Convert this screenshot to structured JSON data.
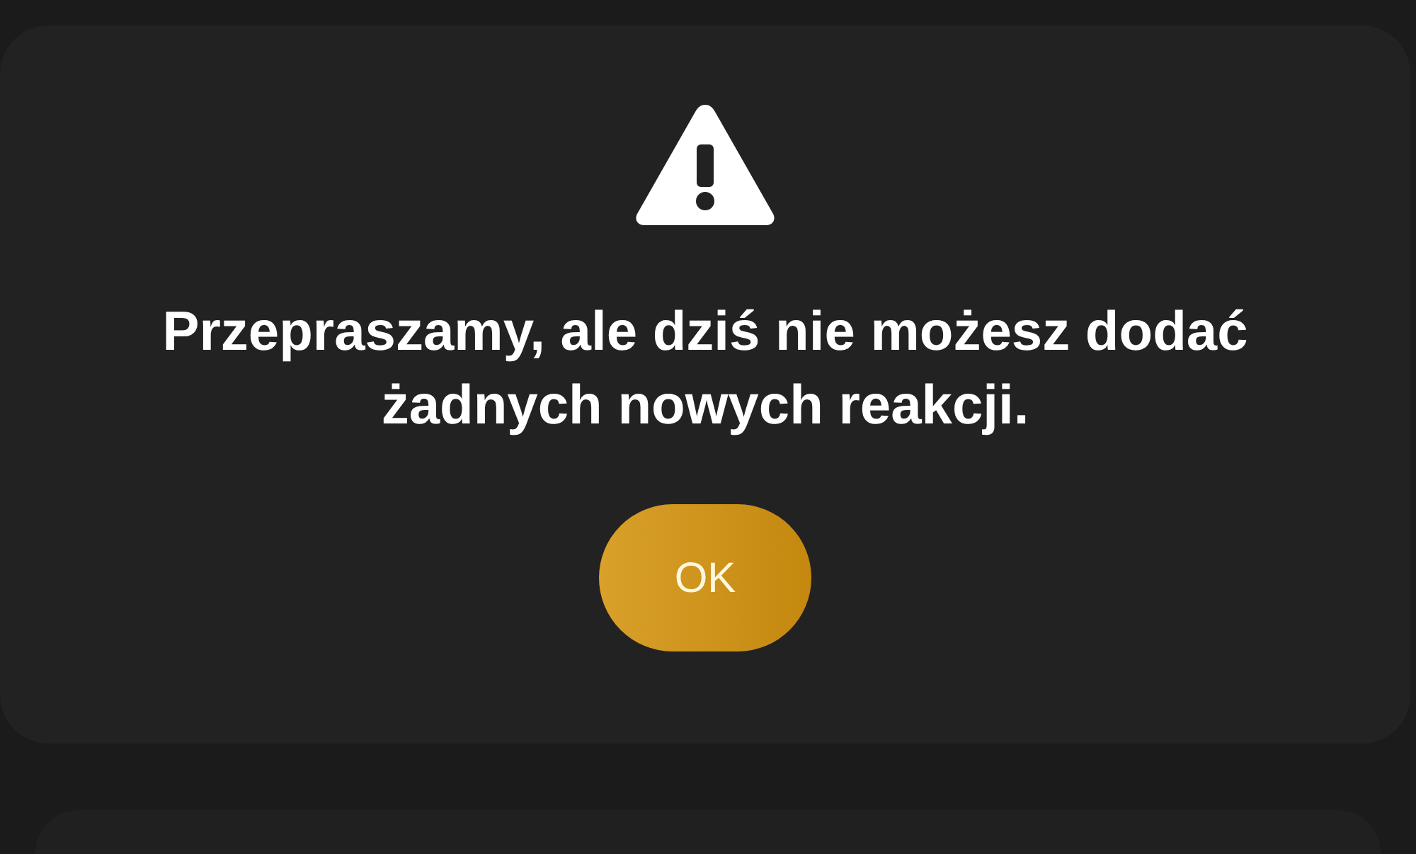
{
  "dialog": {
    "message": "Przepraszamy, ale dziś nie możesz dodać żadnych nowych reakcji.",
    "button": {
      "label": "OK"
    }
  }
}
